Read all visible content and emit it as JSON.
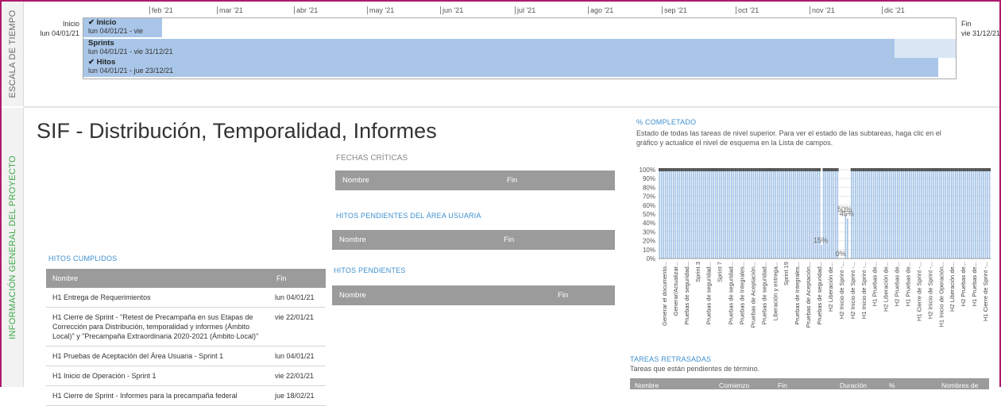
{
  "bands": {
    "top": "ESCALA DE TIEMPO",
    "bottom": "INFORMACIÓN GENERAL DEL PROYECTO"
  },
  "timeline": {
    "months": [
      "feb '21",
      "mar '21",
      "abr '21",
      "may '21",
      "jun '21",
      "jul '21",
      "ago '21",
      "sep '21",
      "oct '21",
      "nov '21",
      "dic '21"
    ],
    "start_label": "Inicio",
    "start_date": "lun 04/01/21",
    "end_label": "Fin",
    "end_date": "vie 31/12/21",
    "bars": [
      {
        "name": "✔ Inicio",
        "dates": "lun 04/01/21 - vie",
        "fill": 0.09
      },
      {
        "name": "Sprints",
        "dates": "lun 04/01/21 - vie 31/12/21",
        "fill": 0.93
      },
      {
        "name": "✔ Hitos",
        "dates": "lun 04/01/21 - jue 23/12/21",
        "fill": 0.98
      }
    ]
  },
  "title": "SIF - Distribución, Temporalidad, Informes",
  "fechas_criticas": {
    "heading": "FECHAS CRÍTICAS",
    "col_name": "Nombre",
    "col_fin": "Fin"
  },
  "hitos_pend_usuaria": {
    "heading": "HITOS PENDIENTES DEL ÁREA USUARIA",
    "col_name": "Nombre",
    "col_fin": "Fin"
  },
  "hitos_pendientes": {
    "heading": "HITOS PENDIENTES",
    "col_name": "Nombre",
    "col_fin": "Fin"
  },
  "hitos_cumplidos": {
    "heading": "HITOS CUMPLIDOS",
    "col_name": "Nombre",
    "col_fin": "Fin",
    "rows": [
      {
        "name": "H1 Entrega de Requerimientos",
        "fin": "lun 04/01/21"
      },
      {
        "name": "H1 Cierre de Sprint - \"Retest de Precampaña en sus Etapas de Corrección para Distribución, temporalidad y informes (Ámbito Local)\" y \"Precampaña Extraordinaria 2020-2021 (Ámbito Local)\"",
        "fin": "vie 22/01/21"
      },
      {
        "name": "H1 Pruebas de Aceptación del Área Usuaria - Sprint 1",
        "fin": "lun 04/01/21"
      },
      {
        "name": "H1 Inicio de Operación - Sprint 1",
        "fin": "vie 22/01/21"
      },
      {
        "name": "H1 Cierre de Sprint - Informes para la precampaña federal",
        "fin": "jue 18/02/21"
      }
    ]
  },
  "completado": {
    "heading": "% COMPLETADO",
    "description": "Estado de todas las tareas de nivel superior. Para ver el estado de las subtareas, haga clic en el gráfico y actualice el nivel de esquema en la Lista de campos."
  },
  "tareas_retrasadas": {
    "heading": "TAREAS RETRASADAS",
    "subtitle": "Tareas que están pendientes de término.",
    "cols": [
      "Nombre",
      "Comienzo",
      "Fin",
      "Duración",
      "%",
      "Nombres de"
    ]
  },
  "chart_data": {
    "type": "bar",
    "yticks": [
      "100%",
      "90%",
      "80%",
      "70%",
      "60%",
      "50%",
      "40%",
      "30%",
      "20%",
      "10%",
      "0%"
    ],
    "ylim": [
      0,
      100
    ],
    "bar_color": "#a9c6e8",
    "categories": [
      "Generar el documento...",
      "Generar/Actualizar...",
      "Pruebas de seguridad...",
      "Sprint 3",
      "Pruebas de seguridad...",
      "Sprint 7",
      "Pruebas de seguridad...",
      "Pruebas de Integrales...",
      "Pruebas de Aceptación...",
      "Pruebas de seguridad...",
      "Liberación y entrega...",
      "Sprint 19",
      "Pruebas de Integrales...",
      "Pruebas de Aceptación...",
      "Pruebas de seguridad...",
      "H2 Liberación de...",
      "H2 Inicio de Sprint -...",
      "H2 Inicio de Sprint -...",
      "H1 Inicio de Sprint -...",
      "H1 Pruebas de...",
      "H2 Liberación de...",
      "H2 Pruebas de...",
      "H1 Pruebas de...",
      "H1 Cierre de Sprint -...",
      "H2 Inicio de Sprint -...",
      "H1 Inicio de Operación...",
      "H2 Liberación de...",
      "H2 Pruebas de...",
      "H1 Pruebas de...",
      "H1 Cierre de Sprint -..."
    ],
    "values": [
      100,
      100,
      100,
      100,
      100,
      100,
      100,
      100,
      100,
      100,
      100,
      100,
      100,
      100,
      100,
      100,
      100,
      100,
      100,
      100,
      100,
      100,
      100,
      100,
      100,
      100,
      100,
      100,
      100,
      100,
      100,
      100,
      100,
      100,
      100,
      100,
      100,
      100,
      100,
      100,
      100,
      100,
      100,
      100,
      100,
      100,
      100,
      100,
      100,
      100,
      100,
      100,
      100,
      100,
      100,
      100,
      100,
      100,
      100,
      100,
      100,
      100,
      100,
      100,
      100,
      100,
      100,
      100,
      100,
      100,
      100,
      100,
      100,
      100,
      100,
      100,
      100,
      100,
      100,
      100,
      100,
      15,
      100,
      100,
      100,
      100,
      100,
      100,
      100,
      100,
      0,
      0,
      0,
      50,
      45,
      0,
      100,
      100,
      100,
      100,
      100,
      100,
      100,
      100,
      100,
      100,
      100,
      100,
      100,
      100,
      100,
      100,
      100,
      100,
      100,
      100,
      100,
      100,
      100,
      100,
      100,
      100,
      100,
      100,
      100,
      100,
      100,
      100,
      100,
      100,
      100,
      100,
      100,
      100,
      100,
      100,
      100,
      100,
      100,
      100,
      100,
      100,
      100,
      100,
      100,
      100,
      100,
      100,
      100,
      100,
      100,
      100,
      100,
      100,
      100,
      100,
      100,
      100,
      100,
      100,
      100,
      100,
      100,
      100,
      100,
      100
    ],
    "data_labels": [
      {
        "text": "15%",
        "value": 15,
        "index": 81
      },
      {
        "text": "50%",
        "value": 50,
        "index": 93
      },
      {
        "text": "45%",
        "value": 45,
        "index": 94
      },
      {
        "text": "0%",
        "value": 0,
        "index": 91
      }
    ]
  }
}
